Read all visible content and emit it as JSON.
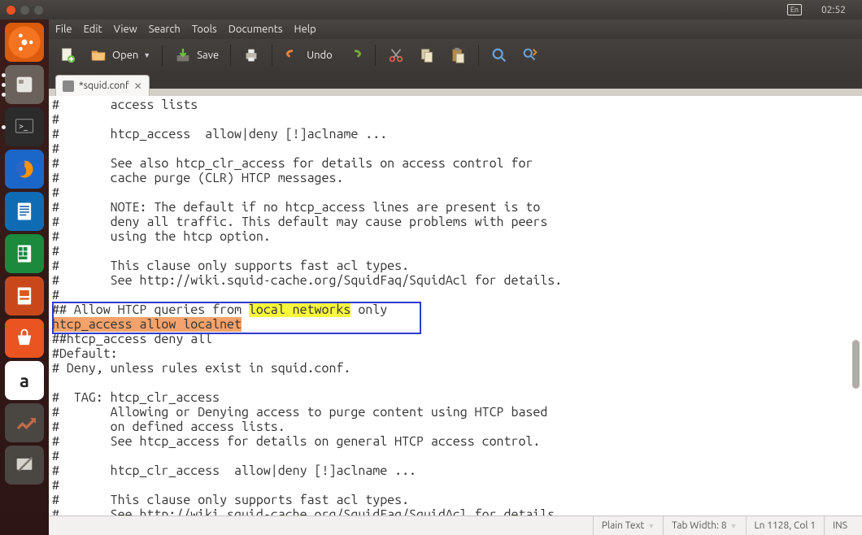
{
  "system": {
    "lang_badge": "En",
    "clock": "02:52",
    "gear": "⚙"
  },
  "launcher": [
    {
      "name": "dash",
      "tip": false
    },
    {
      "name": "files",
      "tip": true
    },
    {
      "name": "terminal",
      "tip": true
    },
    {
      "name": "firefox",
      "tip": false
    },
    {
      "name": "writer",
      "tip": false
    },
    {
      "name": "calc",
      "tip": false
    },
    {
      "name": "impress",
      "tip": false
    },
    {
      "name": "software",
      "tip": false
    },
    {
      "name": "amazon",
      "tip": false
    },
    {
      "name": "settings",
      "tip": false
    },
    {
      "name": "gedit",
      "tip": false
    }
  ],
  "menu": [
    "File",
    "Edit",
    "View",
    "Search",
    "Tools",
    "Documents",
    "Help"
  ],
  "toolbar": {
    "open": "Open",
    "save": "Save",
    "undo": "Undo"
  },
  "tab": {
    "title": "*squid.conf"
  },
  "editor": {
    "pre1": "#       access lists\n#\n#       htcp_access  allow|deny [!]aclname ...\n#\n#       See also htcp_clr_access for details on access control for\n#       cache purge (CLR) HTCP messages.\n#\n#       NOTE: The default if no htcp_access lines are present is to\n#       deny all traffic. This default may cause problems with peers\n#       using the htcp option.\n#\n#       This clause only supports fast acl types.\n#       See http://wiki.squid-cache.org/SquidFaq/SquidAcl for details.\n#\n",
    "boxed": {
      "l1a": "## Allow HTCP queries from ",
      "l1b": "local networks",
      "l1c": " only",
      "l2": "htcp_access allow localnet"
    },
    "post": "##htcp_access deny all\n#Default:\n# Deny, unless rules exist in squid.conf.\n\n#  TAG: htcp_clr_access\n#       Allowing or Denying access to purge content using HTCP based\n#       on defined access lists.\n#       See htcp_access for details on general HTCP access control.\n#\n#       htcp_clr_access  allow|deny [!]aclname ...\n#\n#       This clause only supports fast acl types.\n#       See http://wiki.squid-cache.org/SquidFaq/SquidAcl for details."
  },
  "status": {
    "lang": "Plain Text",
    "tabw": "Tab Width: 8",
    "pos": "Ln 1128, Col 1",
    "ins": "INS"
  }
}
